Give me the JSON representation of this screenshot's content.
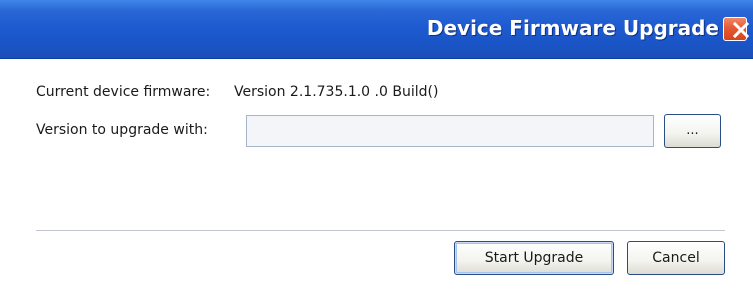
{
  "window": {
    "title": "Device Firmware Upgrade",
    "close_icon": "close-icon"
  },
  "firmware": {
    "current_label": "Current device firmware:",
    "current_value": "Version 2.1.735.1.0 .0 Build()"
  },
  "upgrade": {
    "label": "Version to upgrade with:",
    "path_value": "",
    "browse_label": "..."
  },
  "buttons": {
    "start_label": "Start Upgrade",
    "cancel_label": "Cancel"
  },
  "colors": {
    "titlebar": "#1e5bd0",
    "close_button": "#e65a33",
    "button_border": "#2a4d86",
    "input_background": "#f3f5f8"
  }
}
